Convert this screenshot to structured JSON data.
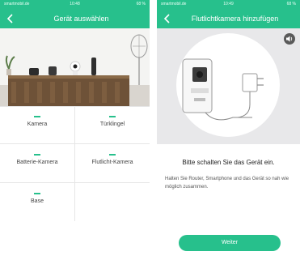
{
  "left_screen": {
    "status": {
      "carrier": "smartmobil.de",
      "time": "10:48",
      "battery": "68 %"
    },
    "title": "Gerät auswählen",
    "devices": [
      {
        "label": "Kamera"
      },
      {
        "label": "Türklingel"
      },
      {
        "label": "Batterie-Kamera"
      },
      {
        "label": "Flutlicht-Kamera"
      },
      {
        "label": "Base"
      }
    ]
  },
  "right_screen": {
    "status": {
      "carrier": "smartmobil.de",
      "time": "10:49",
      "battery": "68 %"
    },
    "title": "Flutlichtkamera hinzufügen",
    "message_title": "Bitte schalten Sie das Gerät ein.",
    "message_body": "Halten Sie Router, Smartphone und das Gerät so nah wie möglich zusammen.",
    "button_label": "Weiter"
  },
  "colors": {
    "accent": "#27c08c",
    "illustration_bg": "#e8e8ea"
  }
}
